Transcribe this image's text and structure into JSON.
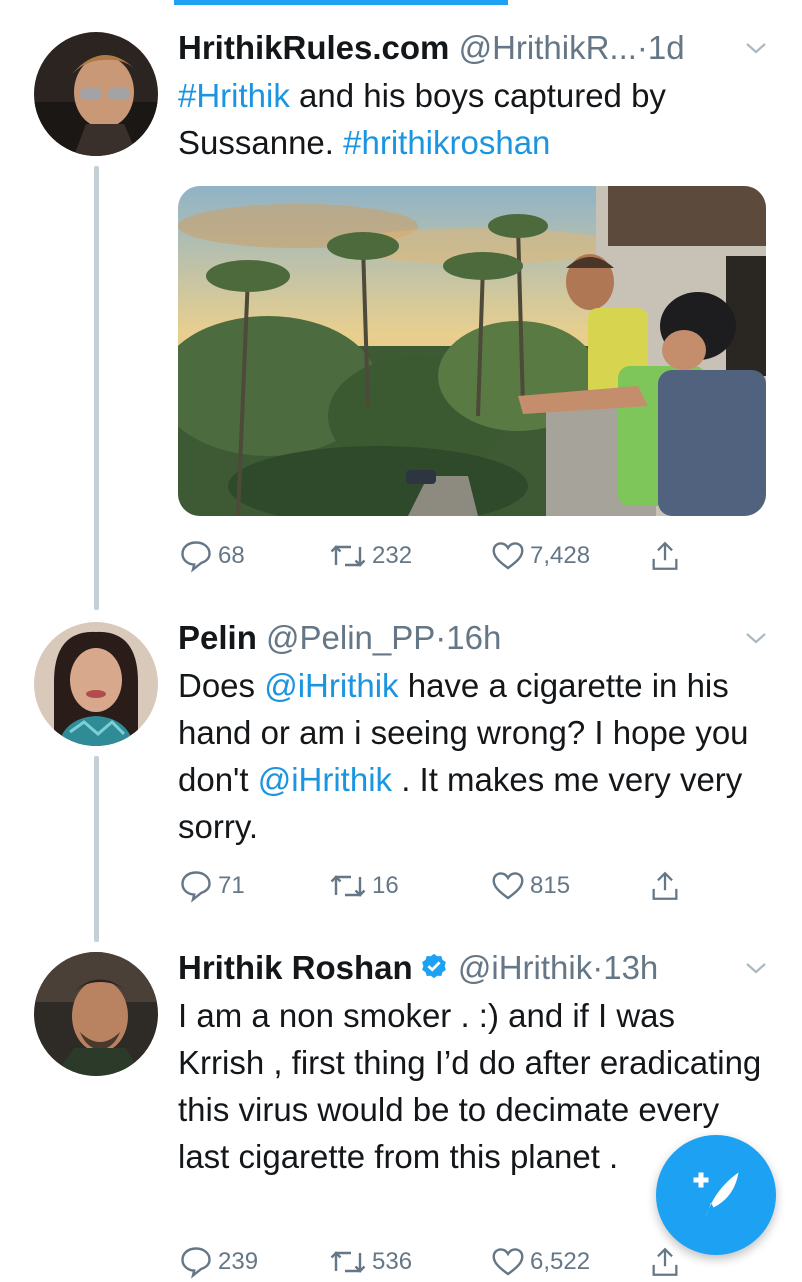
{
  "tweets": [
    {
      "name": "HrithikRules.com",
      "handle": "@HrithikR...",
      "dot": "·",
      "time": "1d",
      "text": [
        {
          "t": "#Hrithik",
          "link": true
        },
        {
          "t": " and his boys captured by Sussanne. ",
          "link": false
        },
        {
          "t": "#hrithikroshan",
          "link": true
        }
      ],
      "replies": "68",
      "retweets": "232",
      "likes": "7,428"
    },
    {
      "name": "Pelin",
      "handle": "@Pelin_PP",
      "dot": "·",
      "time": "16h",
      "text": [
        {
          "t": "Does ",
          "link": false
        },
        {
          "t": "@iHrithik",
          "link": true
        },
        {
          "t": " have a cigarette in his hand or am i seeing wrong? I hope you don't ",
          "link": false
        },
        {
          "t": "@iHrithik",
          "link": true
        },
        {
          "t": " . It makes me very very sorry.",
          "link": false
        }
      ],
      "replies": "71",
      "retweets": "16",
      "likes": "815"
    },
    {
      "name": "Hrithik Roshan",
      "handle": "@iHrithik",
      "dot": "·",
      "time": "13h",
      "verified": true,
      "text": [
        {
          "t": "I am a non smoker . :) and if I was Krrish , first thing I’d do after eradicating this virus would be to decimate every last cigarette f",
          "link": false
        },
        {
          "t": "rom this planet .",
          "link": false
        }
      ],
      "replies": "239",
      "retweets": "536",
      "likes": "6,522"
    }
  ],
  "colors": {
    "accent": "#1da1f2",
    "link": "#1b95e0",
    "muted": "#657786"
  },
  "icons": [
    "reply-icon",
    "retweet-icon",
    "like-icon",
    "share-icon",
    "compose-tweet-icon",
    "chevron-down-icon",
    "verified-badge-icon"
  ]
}
